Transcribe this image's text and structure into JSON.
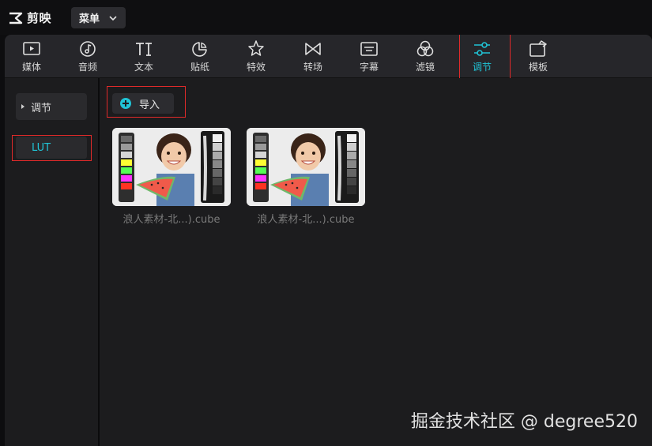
{
  "app": {
    "name": "剪映",
    "menu_label": "菜单"
  },
  "toolbar": {
    "tabs": [
      {
        "id": "media",
        "label": "媒体",
        "icon": "play-square-icon"
      },
      {
        "id": "audio",
        "label": "音频",
        "icon": "music-note-icon"
      },
      {
        "id": "text",
        "label": "文本",
        "icon": "text-TI-icon"
      },
      {
        "id": "sticker",
        "label": "贴纸",
        "icon": "sticker-icon"
      },
      {
        "id": "effects",
        "label": "特效",
        "icon": "sparkle-star-icon"
      },
      {
        "id": "transition",
        "label": "转场",
        "icon": "bowtie-icon"
      },
      {
        "id": "subtitle",
        "label": "字幕",
        "icon": "subtitle-icon"
      },
      {
        "id": "filter",
        "label": "滤镜",
        "icon": "filter-circles-icon"
      },
      {
        "id": "adjust",
        "label": "调节",
        "icon": "sliders-icon",
        "active": true
      },
      {
        "id": "template",
        "label": "模板",
        "icon": "template-icon"
      }
    ],
    "active_color": "#20c4d6"
  },
  "sidebar": {
    "items": [
      {
        "label": "调节",
        "expandable": true
      },
      {
        "label": "LUT",
        "selected": true
      }
    ]
  },
  "content": {
    "import_label": "导入",
    "files": [
      {
        "name": "浪人素材-北...).cube"
      },
      {
        "name": "浪人素材-北...).cube"
      }
    ]
  },
  "watermark": "掘金技术社区 @ degree520",
  "colors": {
    "accent": "#20c4d6",
    "highlight_border": "#e02a2a",
    "background": "#1c1c1e"
  }
}
